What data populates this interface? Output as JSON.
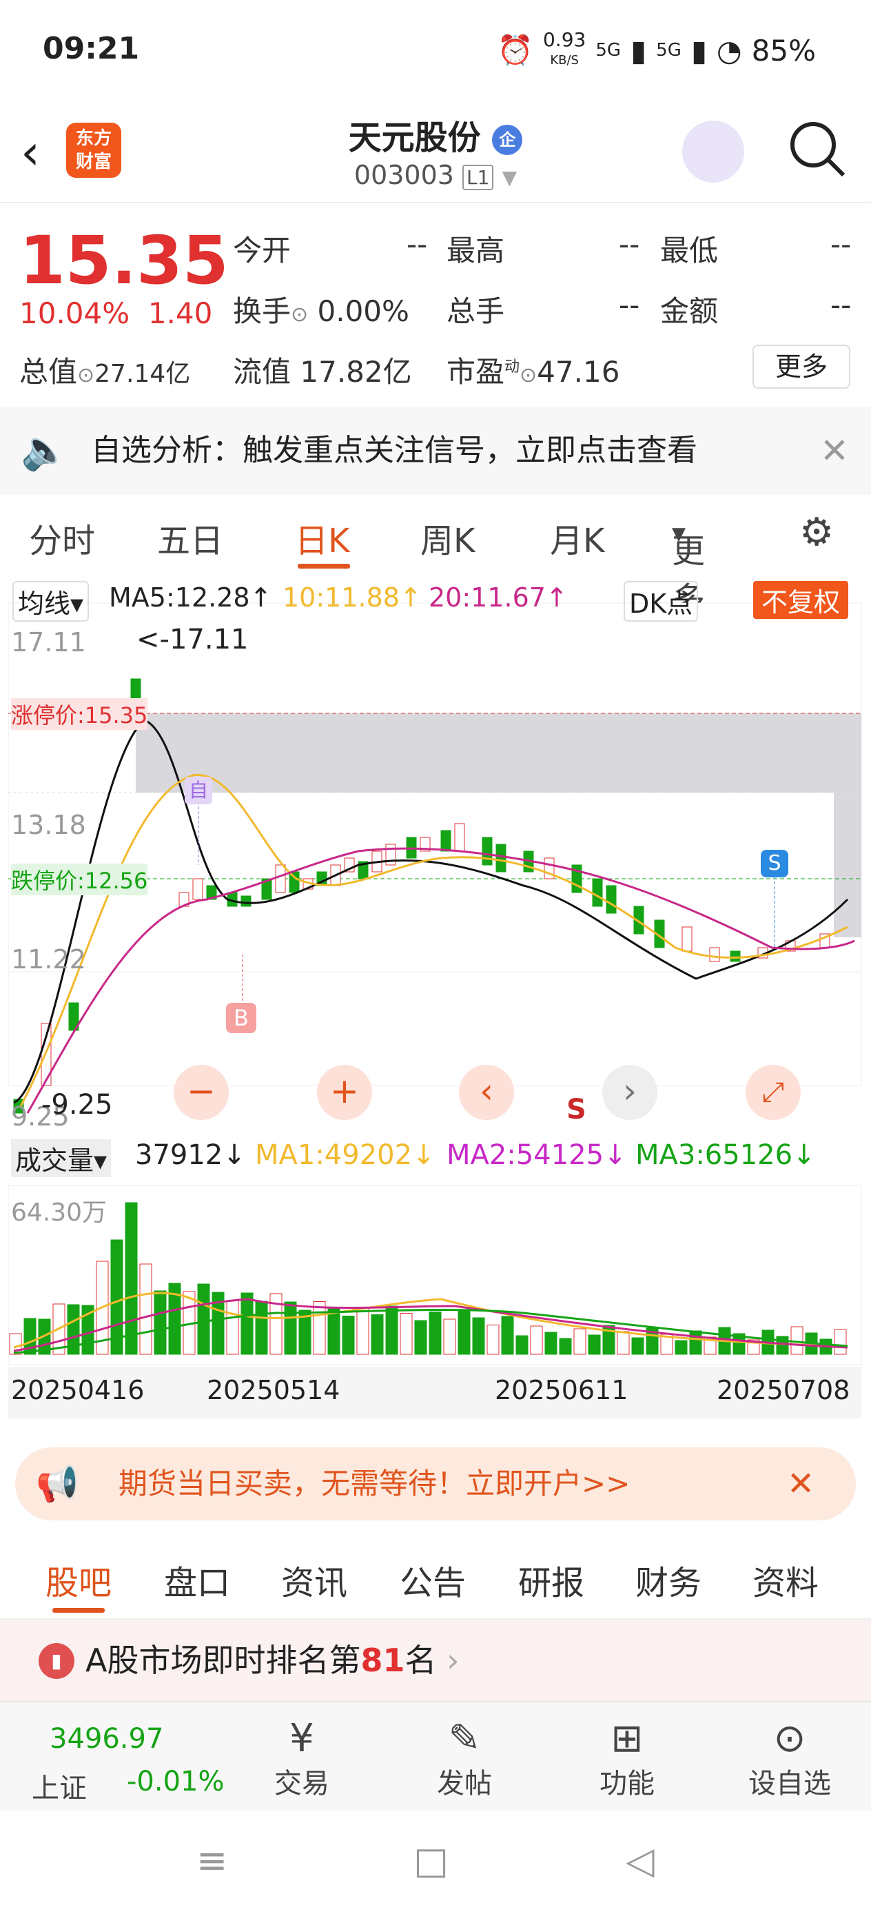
{
  "status": {
    "time": "09:21",
    "speed": "0.93",
    "speed_unit": "KB/S",
    "net1": "5G",
    "net2": "5G",
    "battery": "85%"
  },
  "header": {
    "logo_line1": "东方",
    "logo_line2": "财富",
    "title": "天元股份",
    "title_badge": "企",
    "code": "003003",
    "code_badge": "L1"
  },
  "quote": {
    "price": "15.35",
    "change_pct": "10.04%",
    "change_abs": "1.40",
    "open_label": "今开",
    "open": "--",
    "high_label": "最高",
    "high": "--",
    "low_label": "最低",
    "low": "--",
    "turnover_label": "换手",
    "turnover": "0.00%",
    "vol_label": "总手",
    "vol": "--",
    "amount_label": "金额",
    "amount": "--",
    "mktcap_label": "总值",
    "mktcap": "27.14亿",
    "float_label": "流值",
    "float": "17.82亿",
    "pe_label": "市盈",
    "pe_sup": "动",
    "pe": "47.16",
    "more": "更多"
  },
  "notice": {
    "text": "自选分析：触发重点关注信号，立即点击查看"
  },
  "tabs": [
    "分时",
    "五日",
    "日K",
    "周K",
    "月K",
    "更多",
    "settings"
  ],
  "chart": {
    "ma_select": "均线",
    "ma5": "MA5:12.28↑",
    "ma10": "10:11.88↑",
    "ma20": "20:11.67↑",
    "dk": "DK点",
    "fq": "不复权",
    "y_top": "17.11",
    "y_mid": "13.18",
    "y_low": "11.22",
    "y_bot": "9.25",
    "hi_label": "<-17.11",
    "lo_label": "-9.25",
    "limit_up": "涨停价:15.35",
    "limit_down": "跌停价:12.56",
    "mark_b": "B",
    "mark_s": "S",
    "mark_self": "自",
    "mark_s2": "S",
    "vol_select": "成交量",
    "vol_now": "37912↓",
    "vma1": "MA1:49202↓",
    "vma2": "MA2:54125↓",
    "vma3": "MA3:65126↓",
    "vol_top": "64.30万",
    "dates": [
      "20250416",
      "20250514",
      "20250611",
      "20250708"
    ],
    "colors": {
      "up": "#e03030",
      "down": "#15a415",
      "ma5": "#111111",
      "ma10": "#f2b92d",
      "ma20": "#c8288a"
    }
  },
  "ad": {
    "text": "期货当日买卖，无需等待！立即开户>>"
  },
  "subtabs": [
    "股吧",
    "盘口",
    "资讯",
    "公告",
    "研报",
    "财务",
    "资料"
  ],
  "rank": {
    "prefix": "A股市场即时排名第",
    "num": "81",
    "suffix": "名"
  },
  "bottom": {
    "index_val": "3496.97",
    "index_name": "上证",
    "index_chg": "-0.01%",
    "trade": "交易",
    "post": "发帖",
    "func": "功能",
    "watch": "设自选"
  }
}
